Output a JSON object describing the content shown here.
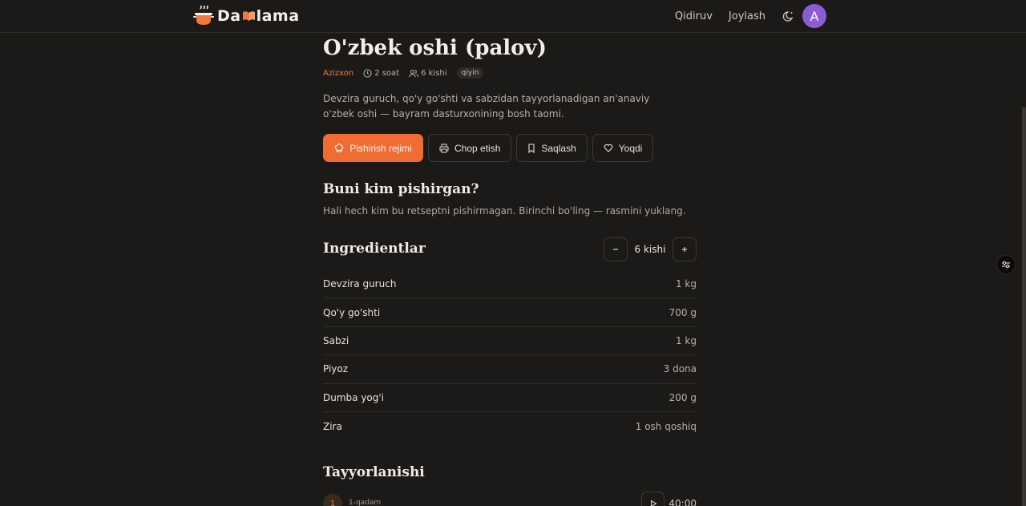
{
  "header": {
    "logo_text_start": "Da",
    "logo_text_end": "ama",
    "nav": {
      "search": "Qidiruv",
      "post": "Joylash"
    },
    "avatar_letter": "A"
  },
  "recipe": {
    "title": "O'zbek oshi (palov)",
    "author": "Azizxon",
    "time": "2 soat",
    "servings": "6 kishi",
    "difficulty": "qiyin",
    "description": "Devzira guruch, qo'y go'shti va sabzidan tayyorlanadigan an'anaviy o'zbek oshi — bayram dasturxonining bosh taomi."
  },
  "actions": {
    "cook_mode": "Pishirish rejimi",
    "print": "Chop etish",
    "save": "Saqlash",
    "like": "Yoqdi"
  },
  "cooked": {
    "title": "Buni kim pishirgan?",
    "text": "Hali hech kim bu retseptni pishirmagan. Birinchi bo'ling — rasmini yuklang."
  },
  "ingredients": {
    "title": "Ingredientlar",
    "servings": "6 kishi",
    "items": [
      {
        "name": "Devzira guruch",
        "qty": "1 kg"
      },
      {
        "name": "Qo'y go'shti",
        "qty": "700 g"
      },
      {
        "name": "Sabzi",
        "qty": "1 kg"
      },
      {
        "name": "Piyoz",
        "qty": "3 dona"
      },
      {
        "name": "Dumba yog'i",
        "qty": "200 g"
      },
      {
        "name": "Zira",
        "qty": "1 osh qoshiq"
      }
    ]
  },
  "steps": {
    "title": "Tayyorlanishi",
    "items": [
      {
        "num": "1",
        "label": "1-qadam",
        "timer": "40:00"
      }
    ]
  },
  "colors": {
    "accent": "#ef6d34",
    "background": "#1c1a18",
    "avatar": "#8b5cd6"
  }
}
